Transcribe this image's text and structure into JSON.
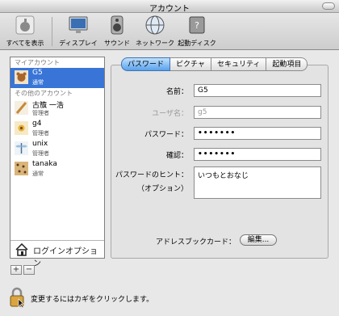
{
  "window": {
    "title": "アカウント"
  },
  "toolbar": {
    "show_all": "すべてを表示",
    "display": "ディスプレイ",
    "sound": "サウンド",
    "network": "ネットワーク",
    "startup_disk": "起動ディスク"
  },
  "accounts": {
    "my_header": "マイアカウント",
    "other_header": "その他のアカウント",
    "me": {
      "name": "G5",
      "role": "通常"
    },
    "others": [
      {
        "name": "古籏 一浩",
        "role": "管理者"
      },
      {
        "name": "g4",
        "role": "管理者"
      },
      {
        "name": "unix",
        "role": "管理者"
      },
      {
        "name": "tanaka",
        "role": "通常"
      }
    ],
    "login_options": "ログインオプション",
    "add": "+",
    "remove": "−"
  },
  "tabs": [
    "パスワード",
    "ピクチャ",
    "セキュリティ",
    "起動項目"
  ],
  "form": {
    "name_label": "名前：",
    "name_value": "G5",
    "username_label": "ユーザ名：",
    "username_value": "g5",
    "password_label": "パスワード：",
    "password_value": "•••••••",
    "confirm_label": "確認：",
    "confirm_value": "•••••••",
    "hint_label": "パスワードのヒント：",
    "hint_optional": "（オプション）",
    "hint_value": "いつもとおなじ",
    "addressbook_label": "アドレスブックカード：",
    "edit_button": "編集..."
  },
  "footer": {
    "lock_text": "変更するにはカギをクリックします。"
  },
  "colors": {
    "selection": "#3875d7",
    "tab_active": "#5aa2ec"
  }
}
